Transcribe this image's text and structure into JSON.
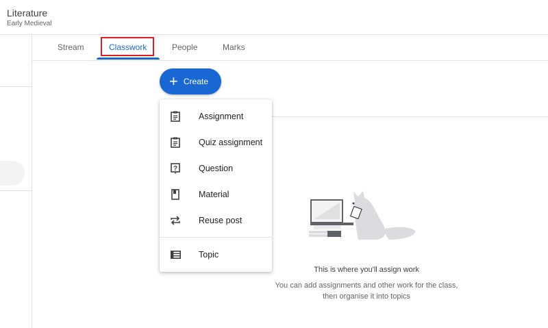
{
  "header": {
    "title": "Literature",
    "subtitle": "Early Medieval"
  },
  "tabs": [
    {
      "label": "Stream"
    },
    {
      "label": "Classwork",
      "active": true
    },
    {
      "label": "People"
    },
    {
      "label": "Marks"
    }
  ],
  "create_button": {
    "label": "Create",
    "icon": "plus-icon"
  },
  "create_menu": {
    "items": [
      {
        "label": "Assignment",
        "icon": "assignment-icon"
      },
      {
        "label": "Quiz assignment",
        "icon": "quiz-assignment-icon"
      },
      {
        "label": "Question",
        "icon": "question-icon"
      },
      {
        "label": "Material",
        "icon": "material-icon"
      },
      {
        "label": "Reuse post",
        "icon": "reuse-icon"
      },
      {
        "label": "Topic",
        "icon": "topic-icon"
      }
    ]
  },
  "empty_state": {
    "title": "This is where you'll assign work",
    "description": "You can add assignments and other work for the class, then organise it into topics"
  },
  "colors": {
    "accent": "#1967d2",
    "highlight": "#e31b23"
  }
}
